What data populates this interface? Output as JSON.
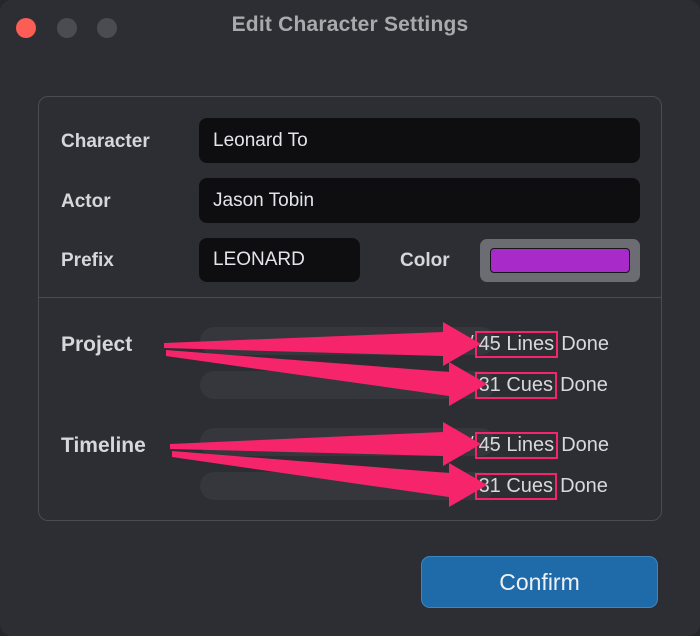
{
  "window": {
    "title": "Edit Character Settings",
    "traffic_lights": [
      {
        "name": "close",
        "color": "#fc5d55"
      },
      {
        "name": "minimize",
        "color": "#4a4c52"
      },
      {
        "name": "maximize",
        "color": "#4a4c52"
      }
    ]
  },
  "form": {
    "character": {
      "label": "Character",
      "value": "Leonard To"
    },
    "actor": {
      "label": "Actor",
      "value": "Jason Tobin"
    },
    "prefix": {
      "label": "Prefix",
      "value": "LEONARD"
    },
    "color": {
      "label": "Color",
      "value": "#a82ac8"
    }
  },
  "progress": {
    "project": {
      "label": "Project",
      "rows": [
        {
          "prefix": "/",
          "boxed": "45 Lines",
          "suffix": "Done"
        },
        {
          "prefix": "/",
          "boxed": "31 Cues",
          "suffix": "Done"
        }
      ]
    },
    "timeline": {
      "label": "Timeline",
      "rows": [
        {
          "prefix": "/",
          "boxed": "45 Lines",
          "suffix": "Done"
        },
        {
          "prefix": "/",
          "boxed": "31 Cues",
          "suffix": "Done"
        }
      ]
    }
  },
  "footer": {
    "confirm_label": "Confirm"
  },
  "annotation": {
    "color": "#f5246b",
    "arrow_count": 4
  }
}
